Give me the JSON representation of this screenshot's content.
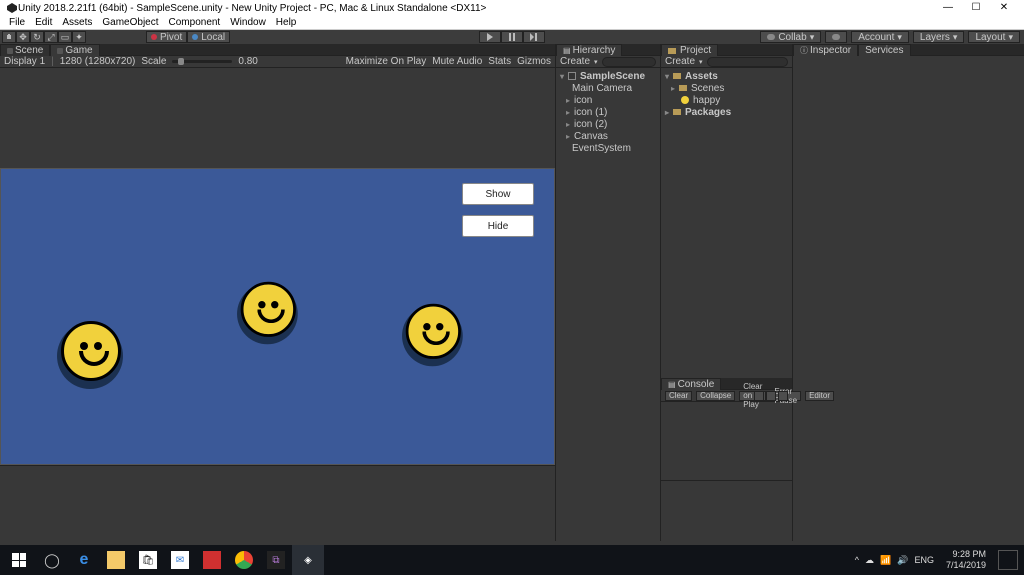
{
  "title_bar": {
    "title": "Unity 2018.2.21f1 (64bit) - SampleScene.unity - New Unity Project - PC, Mac & Linux Standalone <DX11>"
  },
  "menu": [
    "File",
    "Edit",
    "Assets",
    "GameObject",
    "Component",
    "Window",
    "Help"
  ],
  "toolbar": {
    "pivot": "Pivot",
    "local": "Local",
    "collab": "Collab",
    "account": "Account",
    "layers": "Layers",
    "layout": "Layout"
  },
  "tabs": {
    "scene": "Scene",
    "game": "Game",
    "hierarchy": "Hierarchy",
    "project": "Project",
    "console": "Console",
    "inspector": "Inspector",
    "services": "Services"
  },
  "game_toolbar": {
    "display": "Display 1",
    "resolution": "1280  (1280x720)",
    "scale": "Scale",
    "scale_val": "0.80",
    "max_on_play": "Maximize On Play",
    "mute": "Mute Audio",
    "stats": "Stats",
    "gizmos": "Gizmos"
  },
  "game_ui": {
    "show": "Show",
    "hide": "Hide"
  },
  "hierarchy": {
    "create": "Create",
    "scene": "SampleScene",
    "items": [
      "Main Camera",
      "icon",
      "icon (1)",
      "icon (2)",
      "Canvas",
      "EventSystem"
    ]
  },
  "project": {
    "create": "Create",
    "assets": "Assets",
    "items": [
      "Scenes",
      "happy",
      "Packages"
    ]
  },
  "console": {
    "clear": "Clear",
    "collapse": "Collapse",
    "clear_on_play": "Clear on Play",
    "error_pause": "Error Pause",
    "editor": "Editor"
  },
  "taskbar": {
    "lang": "ENG",
    "time": "9:28 PM",
    "date": "7/14/2019"
  }
}
